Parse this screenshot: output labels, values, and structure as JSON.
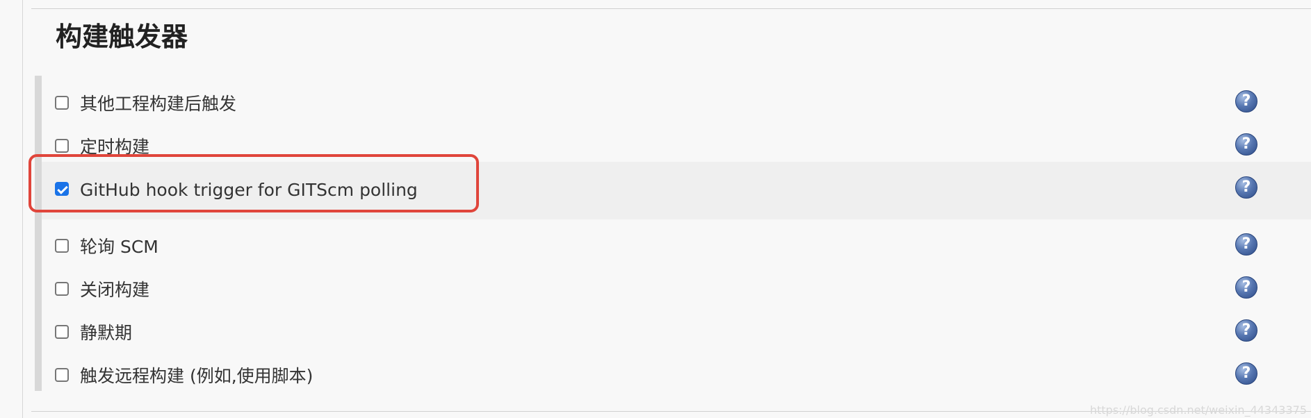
{
  "section": {
    "title": "构建触发器"
  },
  "options": [
    {
      "label": "其他工程构建后触发",
      "checked": false,
      "help_icon": "help-icon"
    },
    {
      "label": "定时构建",
      "checked": false,
      "help_icon": "help-icon"
    },
    {
      "label": "GitHub hook trigger for GITScm polling",
      "checked": true,
      "help_icon": "help-icon"
    },
    {
      "label": "轮询 SCM",
      "checked": false,
      "help_icon": "help-icon"
    },
    {
      "label": "关闭构建",
      "checked": false,
      "help_icon": "help-icon"
    },
    {
      "label": "静默期",
      "checked": false,
      "help_icon": "help-icon"
    },
    {
      "label": "触发远程构建 (例如,使用脚本)",
      "checked": false,
      "help_icon": "help-icon"
    }
  ],
  "colors": {
    "checkbox_checked": "#1a73e8",
    "callout_border": "#e0453b",
    "help_icon": "#4f6fae"
  },
  "watermark": "https://blog.csdn.net/weixin_44343375"
}
